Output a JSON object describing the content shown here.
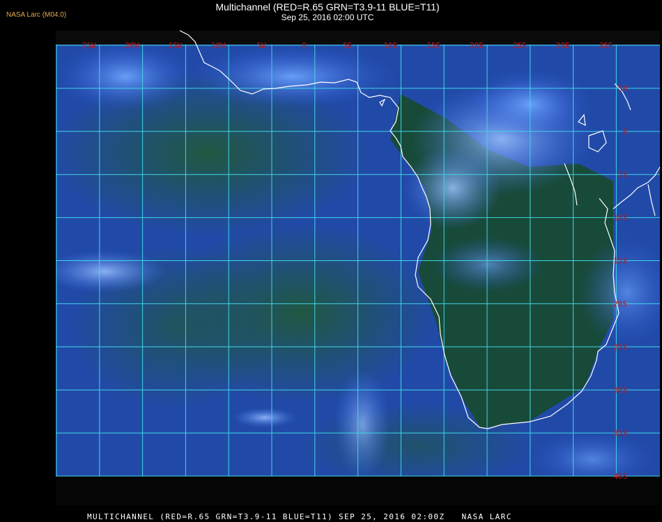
{
  "header": {
    "org_tag": "NASA Larc (M04.0)",
    "title": "Multichannel (RED=R.65 GRN=T3.9-11 BLUE=T11)",
    "subtitle": "Sep 25, 2016 02:00 UTC"
  },
  "footer": {
    "caption": "MULTICHANNEL (RED=R.65 GRN=T3.9-11 BLUE=T11) SEP 25, 2016 02:00Z   NASA LARC"
  },
  "map": {
    "region": "Southern Africa and South Atlantic",
    "grid_color": "#3fd6e6",
    "label_color": "#c01a1a",
    "coastline_color": "#ffffff",
    "longitude_labels": [
      "25W",
      "20W",
      "15W",
      "10W",
      "5W",
      "0",
      "5E",
      "10E",
      "15E",
      "20E",
      "25E",
      "30E",
      "35E"
    ],
    "latitude_labels": [
      "5N",
      "0",
      "5S",
      "10S",
      "15S",
      "20S",
      "25S",
      "30S",
      "35S",
      "40S"
    ]
  }
}
